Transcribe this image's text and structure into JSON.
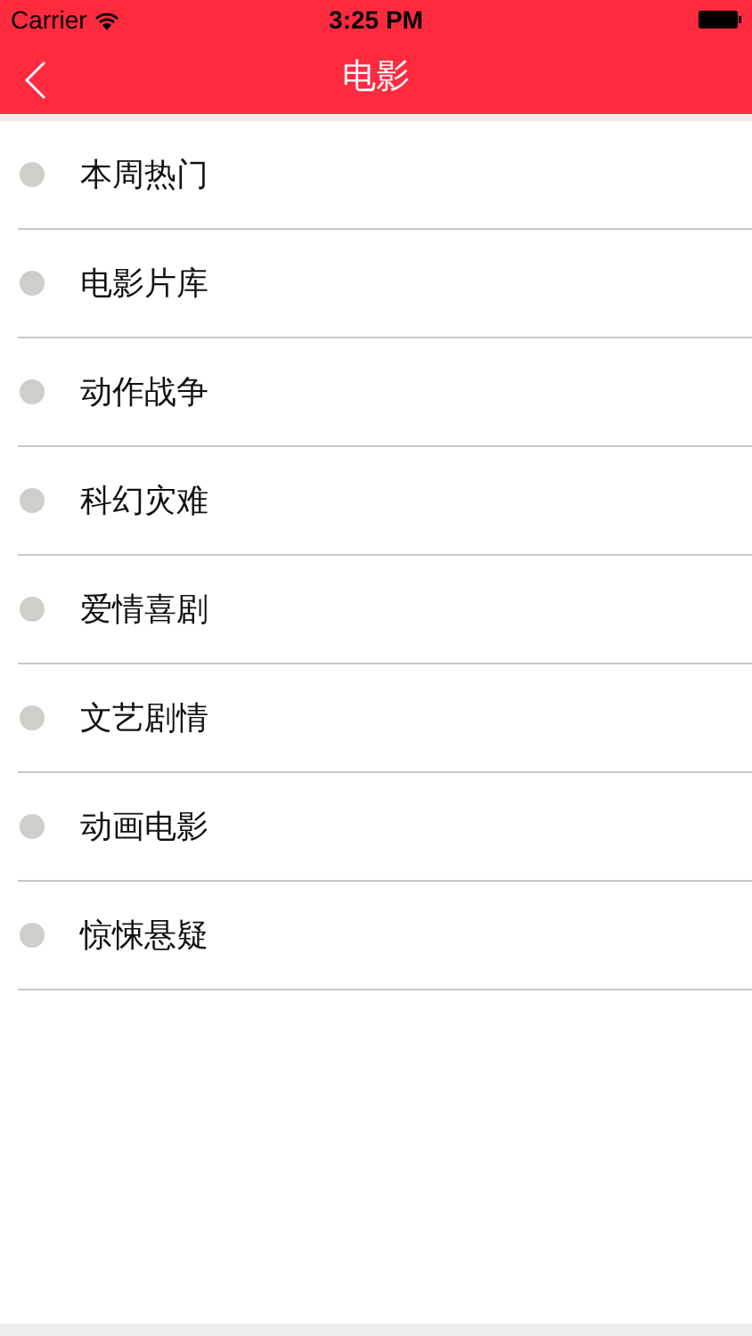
{
  "status_bar": {
    "carrier": "Carrier",
    "time": "3:25 PM"
  },
  "nav_bar": {
    "title": "电影"
  },
  "categories": [
    {
      "label": "本周热门"
    },
    {
      "label": "电影片库"
    },
    {
      "label": "动作战争"
    },
    {
      "label": "科幻灾难"
    },
    {
      "label": "爱情喜剧"
    },
    {
      "label": "文艺剧情"
    },
    {
      "label": "动画电影"
    },
    {
      "label": "惊悚悬疑"
    }
  ]
}
